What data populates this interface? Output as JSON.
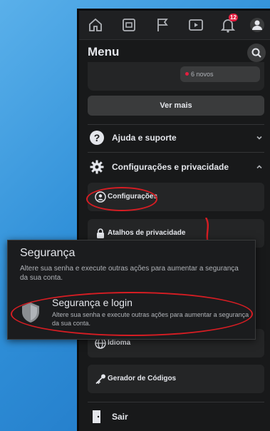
{
  "nav": {
    "icons": [
      "home-icon",
      "pages-icon",
      "flag-icon",
      "watch-icon",
      "bell-icon",
      "menu-avatar-icon"
    ],
    "notification_badge": "12"
  },
  "menu": {
    "title": "Menu",
    "new_items_label": "6 novos",
    "see_more": "Ver mais",
    "help_support": "Ajuda e suporte",
    "settings_privacy": "Configurações e privacidade",
    "settings": "Configurações",
    "privacy_shortcuts": "Atalhos de privacidade",
    "language": "Idioma",
    "code_generator": "Gerador de Códigos",
    "logout": "Sair"
  },
  "popup": {
    "title": "Segurança",
    "description": "Altere sua senha e execute outras ações para aumentar a segurança da sua conta.",
    "item_title": "Segurança e login",
    "item_description": "Altere sua senha e execute outras ações para aumentar a segurança da sua conta."
  },
  "colors": {
    "background_blue": "#2f8fd8",
    "panel_dark": "#18191a",
    "card_dark": "#242526",
    "highlight_red": "#d71d23",
    "notification_red": "#e41e3f"
  }
}
